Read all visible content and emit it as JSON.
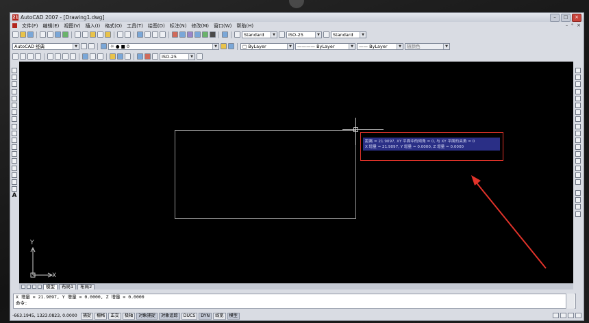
{
  "window": {
    "title": "AutoCAD 2007 - [Drawing1.dwg]",
    "app_badge": "21"
  },
  "menu": [
    "文件(F)",
    "编辑(E)",
    "视图(V)",
    "插入(I)",
    "格式(O)",
    "工具(T)",
    "绘图(D)",
    "标注(N)",
    "修改(M)",
    "窗口(W)",
    "帮助(H)"
  ],
  "toolbar": {
    "text_style": "Standard",
    "dim_style": "ISO-25",
    "table_style": "Standard",
    "workspace": "AutoCAD 经典",
    "layer": "0",
    "color": "ByLayer",
    "linetype": "ByLayer",
    "lineweight": "ByLayer",
    "plot_style": "随颜色",
    "dim_style_2": "ISO-25"
  },
  "canvas": {
    "tooltip_line1": "距离 = 21.9097,  XY 平面中的倾角 = 0,   与 XY 平面的夹角 = 0",
    "tooltip_line2": "X 增量 = 21.9097,   Y 增量 = 0.0000,     Z 增量 = 0.0000",
    "ucs_x": "X",
    "ucs_y": "Y"
  },
  "layout_tabs": [
    "模型",
    "布局1",
    "布局2"
  ],
  "command": {
    "history": "X 增量 = 21.9097,   Y 增量 = 0.0000,    Z 增量 = 0.0000",
    "prompt": "命令:"
  },
  "status": {
    "coords": "-663.1945, 1323.0823, 0.0000",
    "buttons": [
      "捕捉",
      "栅格",
      "正交",
      "极轴",
      "对象捕捉",
      "对象追踪",
      "DUCS",
      "DYN",
      "线宽",
      "模型"
    ]
  },
  "colors": {
    "canvas": "#000000",
    "tooltip": "#2a2f86",
    "annotation": "#e2332a"
  }
}
